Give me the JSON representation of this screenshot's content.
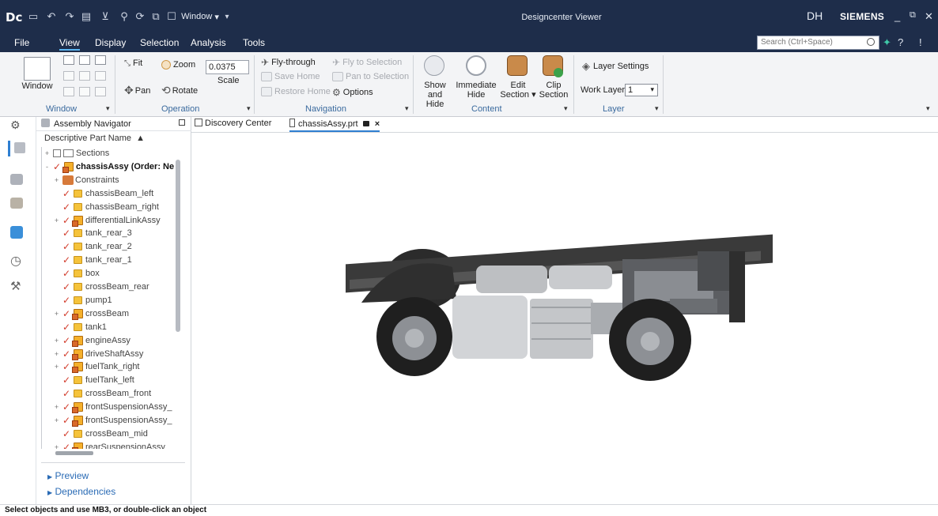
{
  "app": {
    "logo": "Dc",
    "window_menu_label": "Window",
    "title": "Designcenter Viewer",
    "user_initials": "DH",
    "brand": "SIEMENS",
    "search_placeholder": "Search (Ctrl+Space)"
  },
  "menu": [
    "File",
    "View",
    "Display",
    "Selection",
    "Analysis",
    "Tools"
  ],
  "ribbon": {
    "window": {
      "button_label": "Window",
      "group_label": "Window"
    },
    "operation": {
      "fit": "Fit",
      "zoom": "Zoom",
      "zoom_value": "0.0375",
      "scale": "Scale",
      "pan": "Pan",
      "rotate": "Rotate",
      "group_label": "Operation"
    },
    "navigation": {
      "fly_through": "Fly-through",
      "fly_to_selection": "Fly to Selection",
      "save_home": "Save Home",
      "pan_to_selection": "Pan to Selection",
      "restore_home": "Restore Home",
      "options": "Options",
      "group_label": "Navigation"
    },
    "content": {
      "show_hide_line1": "Show",
      "show_hide_line2": "and Hide",
      "immediate_hide_line1": "Immediate",
      "immediate_hide_line2": "Hide",
      "edit_section_line1": "Edit",
      "edit_section_line2": "Section",
      "clip_section_line1": "Clip",
      "clip_section_line2": "Section",
      "group_label": "Content"
    },
    "layer": {
      "layer_settings": "Layer Settings",
      "work_layer_label": "Work Layer",
      "work_layer_value": "1",
      "group_label": "Layer"
    }
  },
  "navigator": {
    "title": "Assembly Navigator",
    "column_header": "Descriptive Part Name",
    "tree": [
      {
        "label": "Sections",
        "kind": "folder",
        "level": 0,
        "expand": "+"
      },
      {
        "label": "chassisAssy (Order: Ne",
        "kind": "assembly",
        "level": 0,
        "expand": "-",
        "bold": true
      },
      {
        "label": "Constraints",
        "kind": "constraints",
        "level": 1,
        "expand": "+"
      },
      {
        "label": "chassisBeam_left",
        "kind": "part",
        "level": 1
      },
      {
        "label": "chassisBeam_right",
        "kind": "part",
        "level": 1
      },
      {
        "label": "differentialLinkAssy",
        "kind": "assembly",
        "level": 1,
        "expand": "+"
      },
      {
        "label": "tank_rear_3",
        "kind": "part",
        "level": 1
      },
      {
        "label": "tank_rear_2",
        "kind": "part",
        "level": 1
      },
      {
        "label": "tank_rear_1",
        "kind": "part",
        "level": 1
      },
      {
        "label": "box",
        "kind": "part",
        "level": 1
      },
      {
        "label": "crossBeam_rear",
        "kind": "part",
        "level": 1
      },
      {
        "label": "pump1",
        "kind": "part",
        "level": 1
      },
      {
        "label": "crossBeam",
        "kind": "assembly",
        "level": 1,
        "expand": "+"
      },
      {
        "label": "tank1",
        "kind": "part",
        "level": 1
      },
      {
        "label": "engineAssy",
        "kind": "assembly",
        "level": 1,
        "expand": "+"
      },
      {
        "label": "driveShaftAssy",
        "kind": "assembly",
        "level": 1,
        "expand": "+"
      },
      {
        "label": "fuelTank_right",
        "kind": "assembly",
        "level": 1,
        "expand": "+"
      },
      {
        "label": "fuelTank_left",
        "kind": "part",
        "level": 1
      },
      {
        "label": "crossBeam_front",
        "kind": "part",
        "level": 1
      },
      {
        "label": "frontSuspensionAssy_",
        "kind": "assembly",
        "level": 1,
        "expand": "+"
      },
      {
        "label": "frontSuspensionAssy_",
        "kind": "assembly",
        "level": 1,
        "expand": "+"
      },
      {
        "label": "crossBeam_mid",
        "kind": "part",
        "level": 1
      },
      {
        "label": "rearSuspensionAssy_",
        "kind": "assembly",
        "level": 1,
        "expand": "+"
      }
    ],
    "preview": "Preview",
    "dependencies": "Dependencies"
  },
  "tabs": [
    {
      "label": "Discovery Center",
      "active": false
    },
    {
      "label": "chassisAssy.prt",
      "active": true
    }
  ],
  "status": "Select objects and use MB3, or double-click an object",
  "colors": {
    "titlebar": "#1e2d4a",
    "accent": "#2f7fd1",
    "check": "#d23b2b",
    "group_label": "#3a6a9e"
  },
  "icons": [
    "undo-icon",
    "redo-icon",
    "print-icon",
    "gear-icon",
    "lock-icon",
    "close-icon",
    "search-icon",
    "help-icon",
    "truck-model"
  ]
}
